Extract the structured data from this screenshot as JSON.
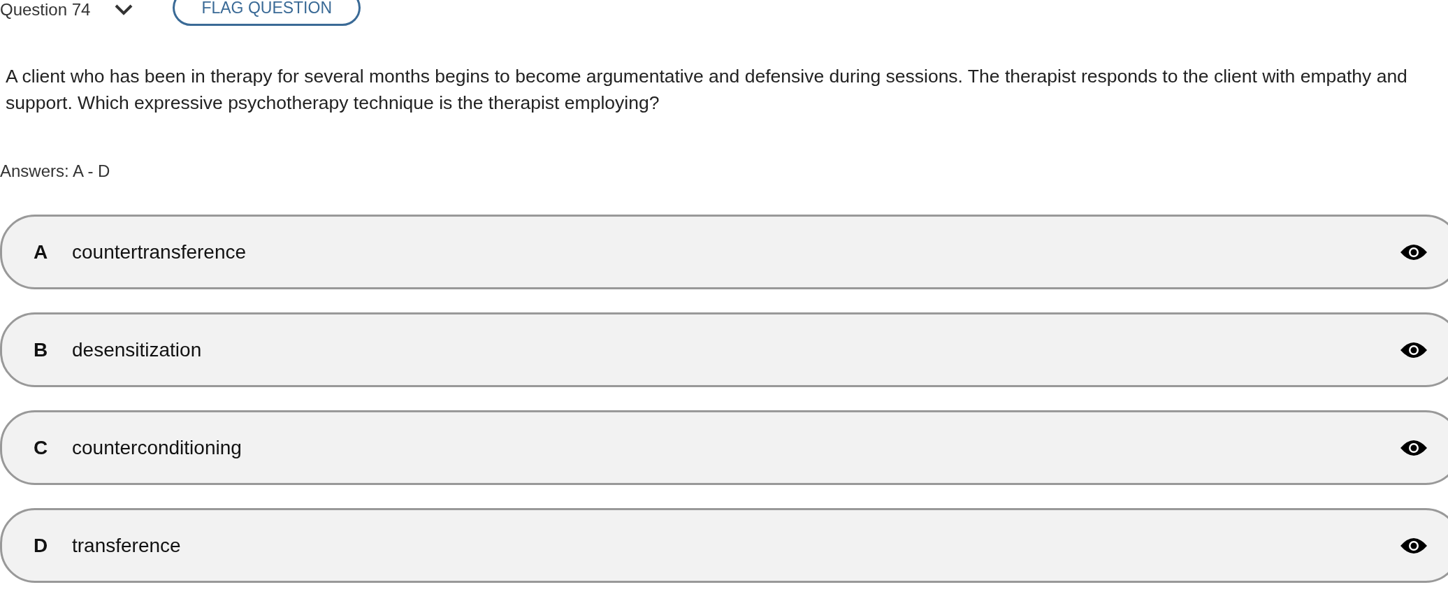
{
  "header": {
    "question_label": "Question 74",
    "flag_button": "FLAG QUESTION"
  },
  "question": "A client who has been in therapy for several months begins to become argumentative and defensive during sessions. The therapist responds to the client with empathy and support. Which expressive psychotherapy technique is the therapist employing?",
  "answers_label": "Answers: A - D",
  "options": [
    {
      "letter": "A",
      "text": "countertransference"
    },
    {
      "letter": "B",
      "text": "desensitization"
    },
    {
      "letter": "C",
      "text": "counterconditioning"
    },
    {
      "letter": "D",
      "text": "transference"
    }
  ]
}
